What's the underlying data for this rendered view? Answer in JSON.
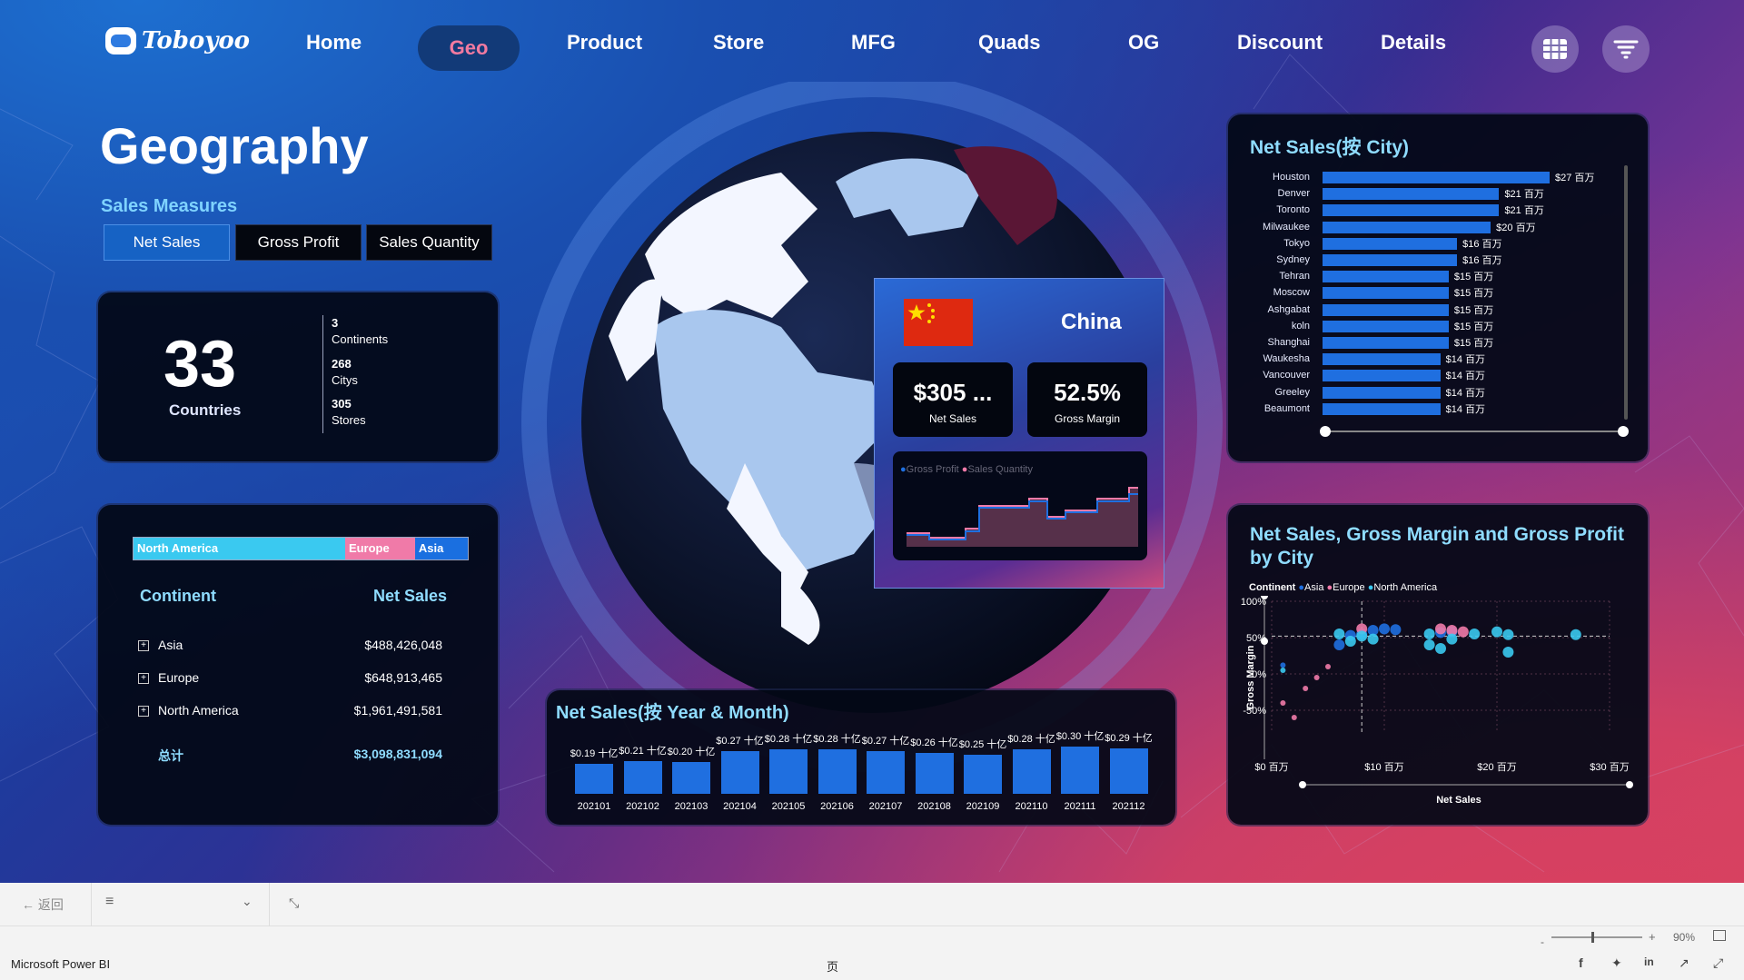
{
  "app": {
    "brand": "Toboyoo",
    "window_title": "Microsoft Power BI",
    "page_indicator": "页"
  },
  "nav": {
    "items": [
      {
        "label": "Home"
      },
      {
        "label": "Geo"
      },
      {
        "label": "Product"
      },
      {
        "label": "Store"
      },
      {
        "label": "MFG"
      },
      {
        "label": "Quads"
      },
      {
        "label": "OG"
      },
      {
        "label": "Discount"
      },
      {
        "label": "Details"
      }
    ],
    "active": "Geo",
    "buttons": [
      "grid-icon",
      "filter-icon"
    ]
  },
  "page": {
    "title": "Geography"
  },
  "measures": {
    "label": "Sales Measures",
    "options": [
      "Net Sales",
      "Gross Profit",
      "Sales Quantity"
    ],
    "selected": "Net Sales"
  },
  "kpi": {
    "countries_value": "33",
    "countries_label": "Countries",
    "continents_value": "3",
    "continents_label": "Continents",
    "citys_value": "268",
    "citys_label": "Citys",
    "stores_value": "305",
    "stores_label": "Stores"
  },
  "continent_table": {
    "stack_bar": [
      {
        "label": "North America",
        "share": 0.633,
        "color": "#3ac9f0"
      },
      {
        "label": "Europe",
        "share": 0.209,
        "color": "#f07aa8"
      },
      {
        "label": "Asia",
        "share": 0.158,
        "color": "#1a6fe0"
      }
    ],
    "col_continent": "Continent",
    "col_sales": "Net Sales",
    "rows": [
      {
        "name": "Asia",
        "value": "$488,426,048"
      },
      {
        "name": "Europe",
        "value": "$648,913,465"
      },
      {
        "name": "North America",
        "value": "$1,961,491,581"
      }
    ],
    "total_label": "总计",
    "total_value": "$3,098,831,094"
  },
  "china_popup": {
    "country": "China",
    "net_sales_value": "$305 ...",
    "net_sales_label": "Net Sales",
    "gross_margin_value": "52.5%",
    "gross_margin_label": "Gross Margin",
    "legend": [
      {
        "label": "Gross Profit",
        "color": "#1f6fe0"
      },
      {
        "label": "Sales Quantity",
        "color": "#f07aa8"
      }
    ]
  },
  "city_chart": {
    "title": "Net Sales(按 City)",
    "chart_data": {
      "type": "bar",
      "categories": [
        "Houston",
        "Denver",
        "Toronto",
        "Milwaukee",
        "Tokyo",
        "Sydney",
        "Tehran",
        "Moscow",
        "Ashgabat",
        "koln",
        "Shanghai",
        "Waukesha",
        "Vancouver",
        "Greeley",
        "Beaumont"
      ],
      "values": [
        27,
        21,
        21,
        20,
        16,
        16,
        15,
        15,
        15,
        15,
        15,
        14,
        14,
        14,
        14
      ],
      "labels": [
        "$27 百万",
        "$21 百万",
        "$21 百万",
        "$20 百万",
        "$16 百万",
        "$16 百万",
        "$15 百万",
        "$15 百万",
        "$15 百万",
        "$15 百万",
        "$15 百万",
        "$14 百万",
        "$14 百万",
        "$14 百万",
        "$14 百万"
      ]
    }
  },
  "monthly_chart": {
    "title": "Net Sales(按 Year & Month)",
    "chart_data": {
      "type": "bar",
      "categories": [
        "202101",
        "202102",
        "202103",
        "202104",
        "202105",
        "202106",
        "202107",
        "202108",
        "202109",
        "202110",
        "202111",
        "202112"
      ],
      "values": [
        0.19,
        0.21,
        0.2,
        0.27,
        0.28,
        0.28,
        0.27,
        0.26,
        0.25,
        0.28,
        0.3,
        0.29
      ],
      "labels": [
        "$0.19 十亿",
        "$0.21 十亿",
        "$0.20 十亿",
        "$0.27 十亿",
        "$0.28 十亿",
        "$0.28 十亿",
        "$0.27 十亿",
        "$0.26 十亿",
        "$0.25 十亿",
        "$0.28 十亿",
        "$0.30 十亿",
        "$0.29 十亿"
      ]
    }
  },
  "scatter_chart": {
    "title_line1": "Net Sales, Gross Margin and Gross Profit",
    "title_line2": "by City",
    "legend_title": "Continent",
    "legend": [
      {
        "label": "Asia",
        "color": "#1f6fe0"
      },
      {
        "label": "Europe",
        "color": "#f07aa8"
      },
      {
        "label": "North America",
        "color": "#3ac9f0"
      }
    ],
    "xlabel": "Net Sales",
    "ylabel": "Gross Margin",
    "x_ticks": [
      "$0 百万",
      "$10 百万",
      "$20 百万",
      "$30 百万"
    ],
    "y_ticks": [
      "100%",
      "50%",
      "0%",
      "-50%"
    ],
    "chart_data": {
      "type": "scatter",
      "xlim": [
        0,
        30
      ],
      "ylim": [
        -80,
        100
      ],
      "series": [
        {
          "name": "Asia",
          "points": [
            [
              7,
              53
            ],
            [
              8,
              55
            ],
            [
              9,
              60
            ],
            [
              10,
              62
            ],
            [
              11,
              61
            ],
            [
              15,
              57
            ],
            [
              16,
              58
            ],
            [
              6,
              40
            ],
            [
              1,
              12
            ]
          ]
        },
        {
          "name": "Europe",
          "points": [
            [
              2,
              -60
            ],
            [
              3,
              -20
            ],
            [
              4,
              -5
            ],
            [
              5,
              10
            ],
            [
              8,
              62
            ],
            [
              15,
              62
            ],
            [
              16,
              60
            ],
            [
              17,
              58
            ],
            [
              1,
              -40
            ]
          ]
        },
        {
          "name": "North America",
          "points": [
            [
              6,
              55
            ],
            [
              7,
              45
            ],
            [
              8,
              52
            ],
            [
              9,
              48
            ],
            [
              14,
              55
            ],
            [
              14,
              40
            ],
            [
              15,
              35
            ],
            [
              16,
              48
            ],
            [
              18,
              55
            ],
            [
              20,
              58
            ],
            [
              21,
              54
            ],
            [
              21,
              30
            ],
            [
              27,
              54
            ],
            [
              1,
              5
            ]
          ]
        }
      ]
    }
  },
  "toolbar": {
    "back_label": "返回"
  },
  "status": {
    "zoom": "90%"
  }
}
